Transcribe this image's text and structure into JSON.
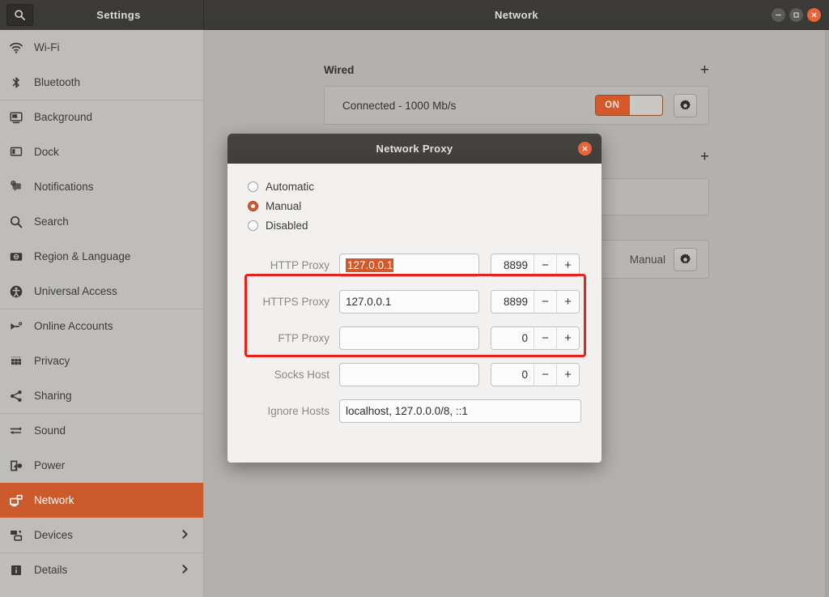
{
  "window": {
    "settings_title": "Settings",
    "page_title": "Network",
    "search_icon": "search-icon",
    "controls": {
      "minimize": "minimize-icon",
      "maximize": "maximize-icon",
      "close": "close-icon"
    }
  },
  "sidebar": {
    "items": [
      {
        "label": "Wi-Fi",
        "icon": "wifi-icon",
        "active": false,
        "chevron": false
      },
      {
        "label": "Bluetooth",
        "icon": "bluetooth-icon",
        "active": false,
        "chevron": false
      },
      {
        "label": "Background",
        "icon": "background-icon",
        "active": false,
        "chevron": false
      },
      {
        "label": "Dock",
        "icon": "dock-icon",
        "active": false,
        "chevron": false
      },
      {
        "label": "Notifications",
        "icon": "notifications-icon",
        "active": false,
        "chevron": false
      },
      {
        "label": "Search",
        "icon": "search-icon",
        "active": false,
        "chevron": false
      },
      {
        "label": "Region & Language",
        "icon": "region-language-icon",
        "active": false,
        "chevron": false
      },
      {
        "label": "Universal Access",
        "icon": "universal-access-icon",
        "active": false,
        "chevron": false
      },
      {
        "label": "Online Accounts",
        "icon": "online-accounts-icon",
        "active": false,
        "chevron": false
      },
      {
        "label": "Privacy",
        "icon": "privacy-icon",
        "active": false,
        "chevron": false
      },
      {
        "label": "Sharing",
        "icon": "sharing-icon",
        "active": false,
        "chevron": false
      },
      {
        "label": "Sound",
        "icon": "sound-icon",
        "active": false,
        "chevron": false
      },
      {
        "label": "Power",
        "icon": "power-icon",
        "active": false,
        "chevron": false
      },
      {
        "label": "Network",
        "icon": "network-icon",
        "active": true,
        "chevron": false
      },
      {
        "label": "Devices",
        "icon": "devices-icon",
        "active": false,
        "chevron": true
      },
      {
        "label": "Details",
        "icon": "details-icon",
        "active": false,
        "chevron": true
      }
    ]
  },
  "main": {
    "wired": {
      "heading": "Wired",
      "add_label": "+",
      "status": "Connected - 1000 Mb/s",
      "toggle_state": "ON",
      "settings_icon": "gear-icon"
    },
    "second_section": {
      "add_label": "+"
    },
    "proxy_row": {
      "value": "Manual",
      "settings_icon": "gear-icon"
    }
  },
  "dialog": {
    "title": "Network Proxy",
    "close_icon": "close-icon",
    "modes": [
      {
        "label": "Automatic",
        "selected": false
      },
      {
        "label": "Manual",
        "selected": true
      },
      {
        "label": "Disabled",
        "selected": false
      }
    ],
    "fields": [
      {
        "label": "HTTP Proxy",
        "value": "127.0.0.1",
        "selected": true,
        "port": "8899"
      },
      {
        "label": "HTTPS Proxy",
        "value": "127.0.0.1",
        "selected": false,
        "port": "8899"
      },
      {
        "label": "FTP Proxy",
        "value": "",
        "selected": false,
        "port": "0"
      },
      {
        "label": "Socks Host",
        "value": "",
        "selected": false,
        "port": "0"
      }
    ],
    "ignore_hosts": {
      "label": "Ignore Hosts",
      "value": "localhost, 127.0.0.0/8, ::1"
    },
    "spinner": {
      "decrement": "−",
      "increment": "+"
    }
  },
  "colors": {
    "accent": "#d4582a",
    "sidebar_active": "#cb5a2c",
    "annotation": "#e8211a",
    "titlebar": "#3c3b37"
  }
}
